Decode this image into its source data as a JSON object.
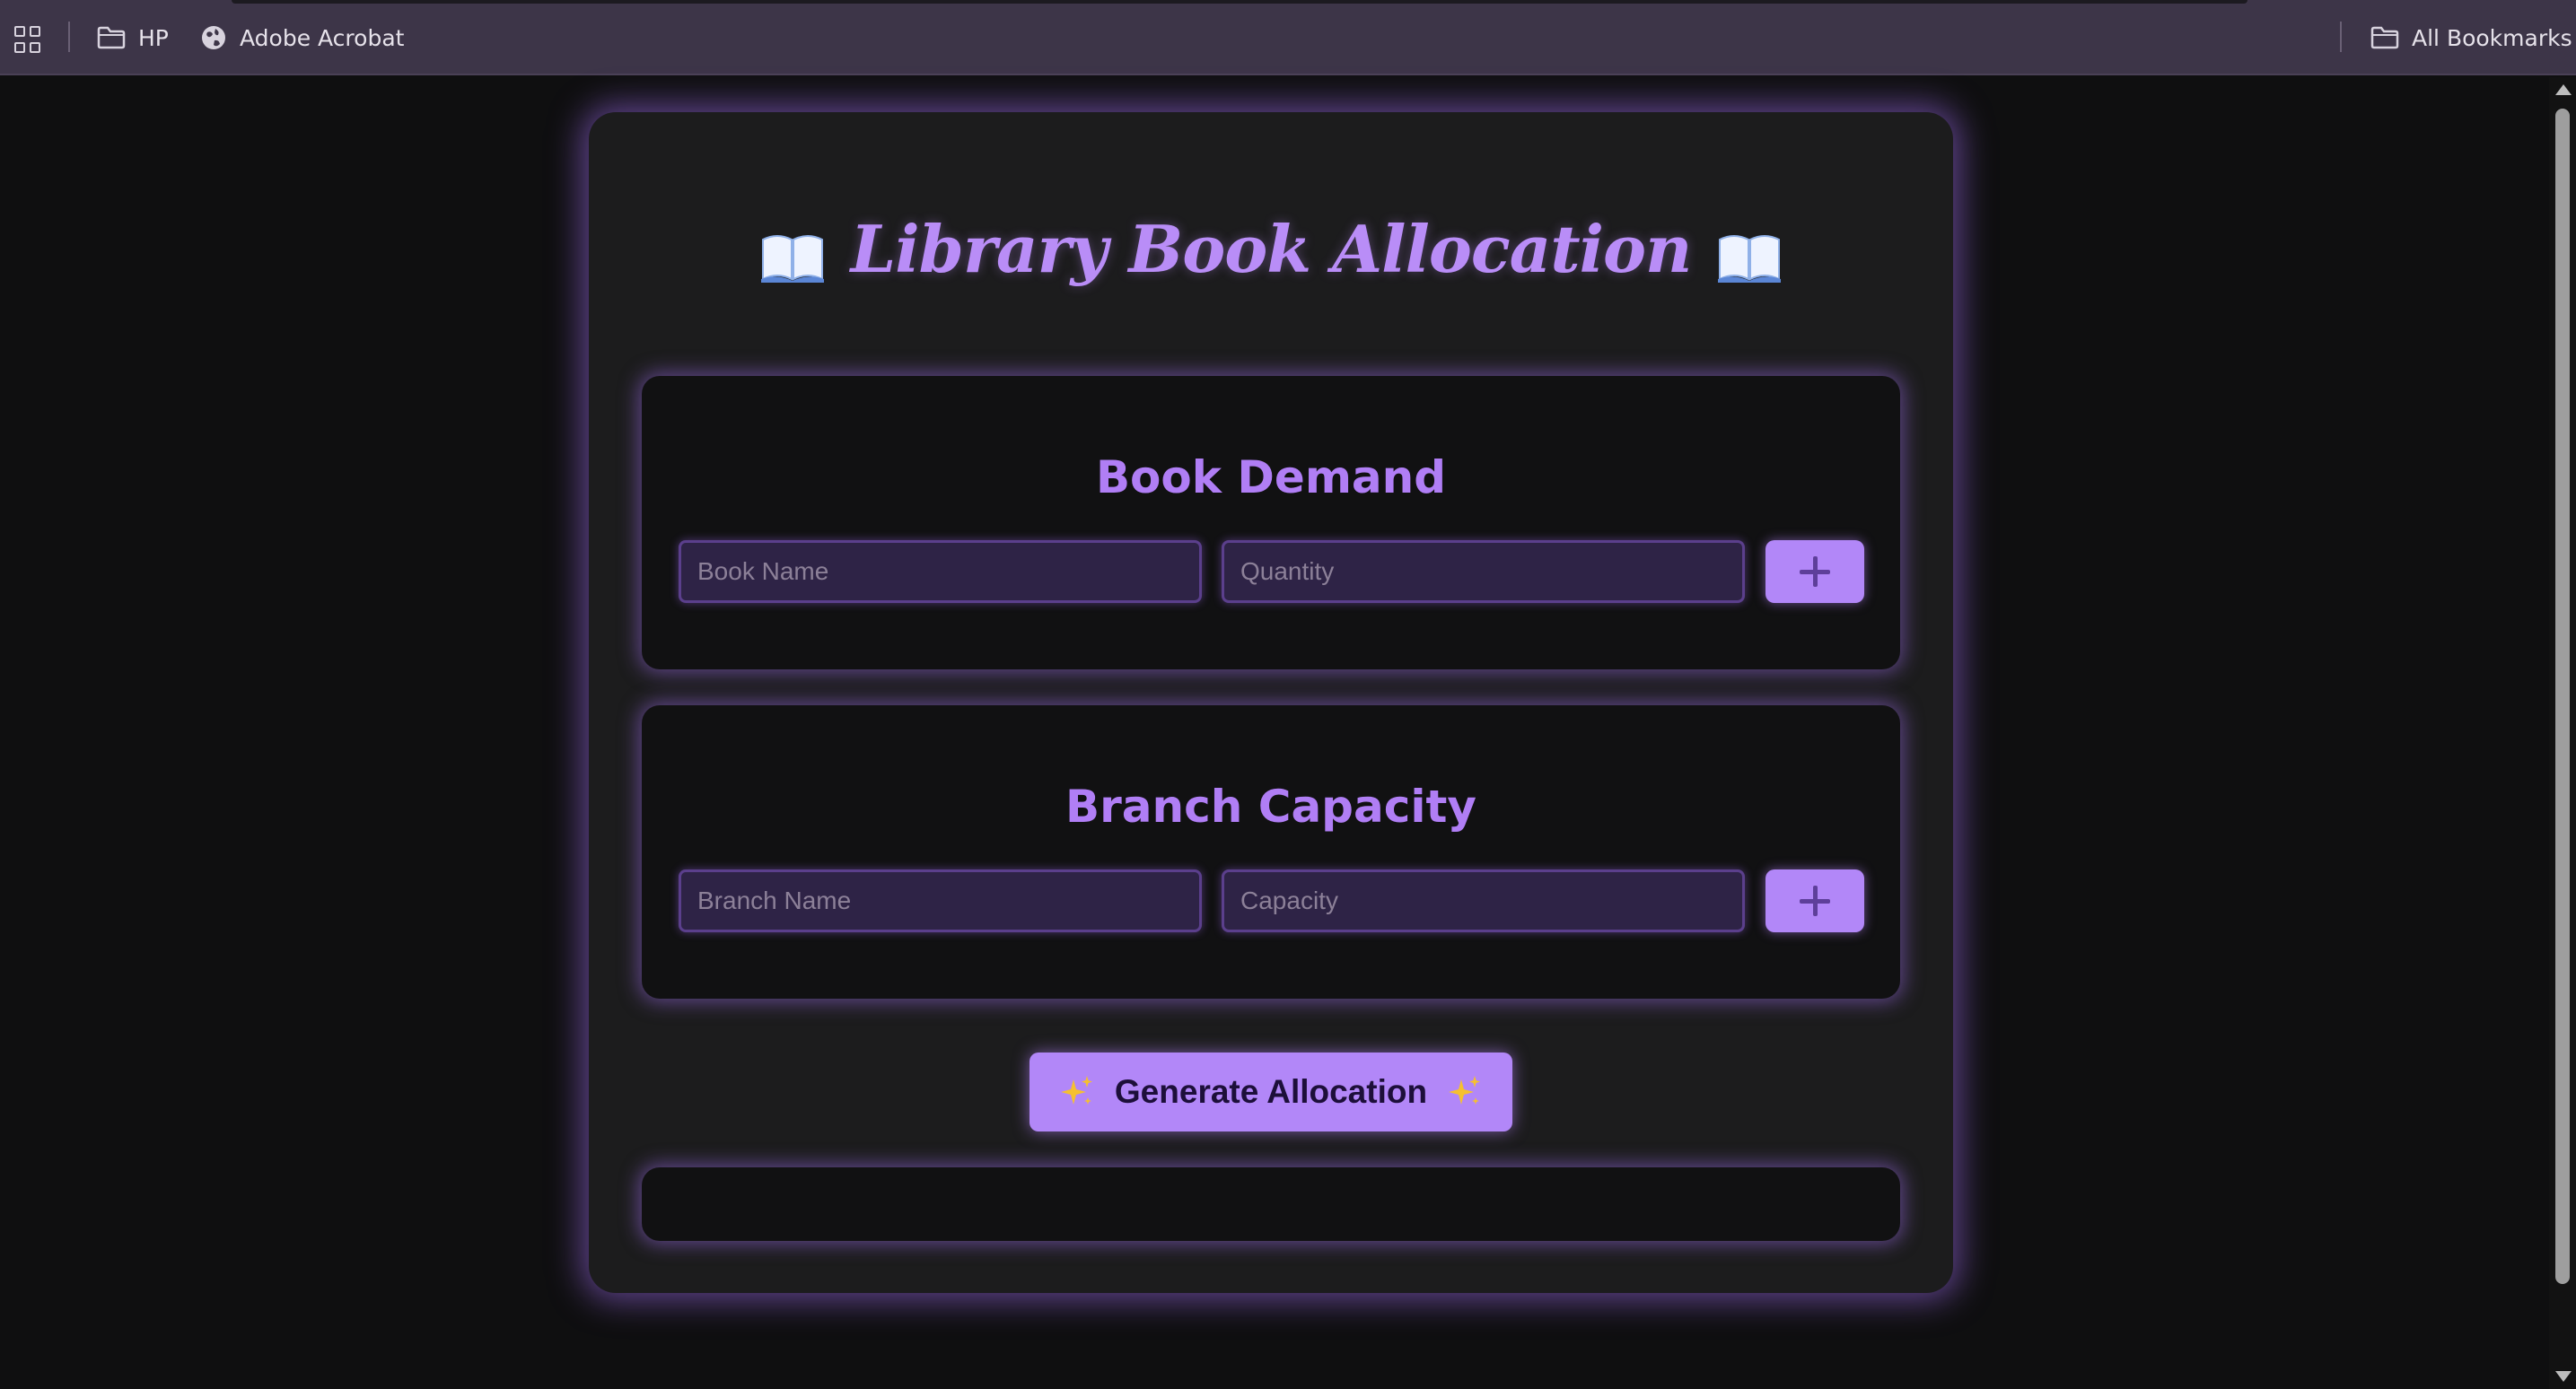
{
  "bookmarks_bar": {
    "items": [
      {
        "label": "HP",
        "icon": "folder-icon"
      },
      {
        "label": "Adobe Acrobat",
        "icon": "globe-icon"
      }
    ],
    "all_bookmarks_label": "All Bookmarks"
  },
  "app": {
    "title": "Library Book Allocation",
    "title_icon": "open-book-icon",
    "accent_color": "#b287f8"
  },
  "book_demand": {
    "heading": "Book Demand",
    "name_placeholder": "Book Name",
    "quantity_placeholder": "Quantity",
    "add_symbol": "+"
  },
  "branch_capacity": {
    "heading": "Branch Capacity",
    "name_placeholder": "Branch Name",
    "capacity_placeholder": "Capacity",
    "add_symbol": "+"
  },
  "generate": {
    "label": "Generate Allocation",
    "icon": "sparkles-icon"
  },
  "result": {
    "text": ""
  }
}
